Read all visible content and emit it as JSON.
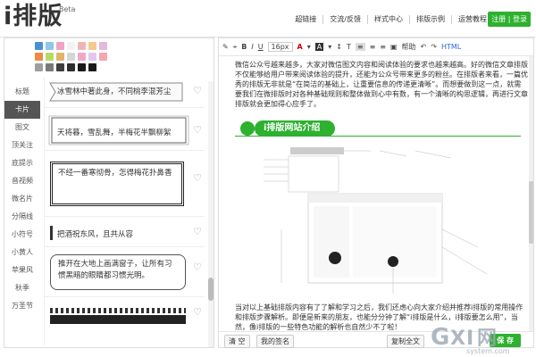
{
  "app": {
    "logo": "i排版",
    "beta": "Beta"
  },
  "topnav": [
    "超链接",
    "交流/反馈",
    "样式中心",
    "排版示例",
    "运营教程"
  ],
  "auth": "注册 | 登录",
  "swatches": [
    [
      "#4b8fd6",
      "#8fc6ea",
      "#f0a3c4",
      "#f3f3f3",
      "#efb5b5",
      "#f3c98c",
      "#e6b8d9"
    ],
    [
      "#ef8a46",
      "#b7db67",
      "#e0b56b",
      "#d6d6d6",
      "#f1a7c8",
      "#e2c6ef",
      "#f4a6b2"
    ],
    [
      "#9e9e9e",
      "#7a7a7a",
      "#3f3f3f",
      "#2e2e2e",
      "#1a1a1a",
      "#1a1a1a"
    ]
  ],
  "categories": [
    "标题",
    "卡片",
    "图文",
    "顶关注",
    "底提示",
    "音视频",
    "微名片",
    "分隔线",
    "小符号",
    "小黄人",
    "苹果风",
    "秋季",
    "万圣节"
  ],
  "items": [
    {
      "text": "冰雪林中著此身，不同桃李混芳尘",
      "style": "ribbon"
    },
    {
      "text": "天将暮，雪乱舞，半梅花半飘柳絮",
      "style": "scroll"
    },
    {
      "text": "不经一番寒彻骨，怎得梅花扑鼻香",
      "style": "bold"
    },
    {
      "text": "把酒祝东风，且共从容",
      "style": "bar"
    },
    {
      "text": "推开在大地上画满窗子，让所有习惯黑暗的眼睛都习惯光明。",
      "style": "round"
    },
    {
      "text": "",
      "style": "stripe"
    }
  ],
  "toolbar": {
    "fontsize": "16px",
    "mark": "A",
    "font": "A",
    "bold": "B",
    "italic": "I",
    "underline": "U",
    "help": "帮助",
    "html": "HTML"
  },
  "editor": {
    "para1": "微信公众号越来越多，大家对微信图文内容和阅读体验的要求也越来越高。好的微信文章排版不仅能够给用户带来阅读体验的提升，还能为公众号带来更多的粉丝。在排版者来看，一篇优秀的排版无非就是“在简洁的基础上，让重要信息的传递更清晰”。而想要做到这一点，就需要我们在微排版时对各种基础规则和整体做到心中有数，有一个清晰的构思逻辑，再进行文章排版就会更加得心应手了。",
    "section_title": "i排版网站介绍",
    "para2": "当对以上基础排版内容有了了解和学习之后，我们还虑心向大家介绍并推荐i排版的常用操作和排版步骤解析。即便是新来的朋友，也能分分钟了解“i排版是什么，i排版要怎么用”，当然，像i排版的一些特色功能的解析也自然少不了啦！"
  },
  "footer": {
    "clear": "清 空",
    "signature": "我的签名",
    "copy": "复制全文",
    "save": "保 存"
  },
  "watermark": {
    "brand": "G X I 网",
    "url": "system.com"
  },
  "colors": {
    "accent": "#2db12f",
    "border": "#dddddd"
  }
}
